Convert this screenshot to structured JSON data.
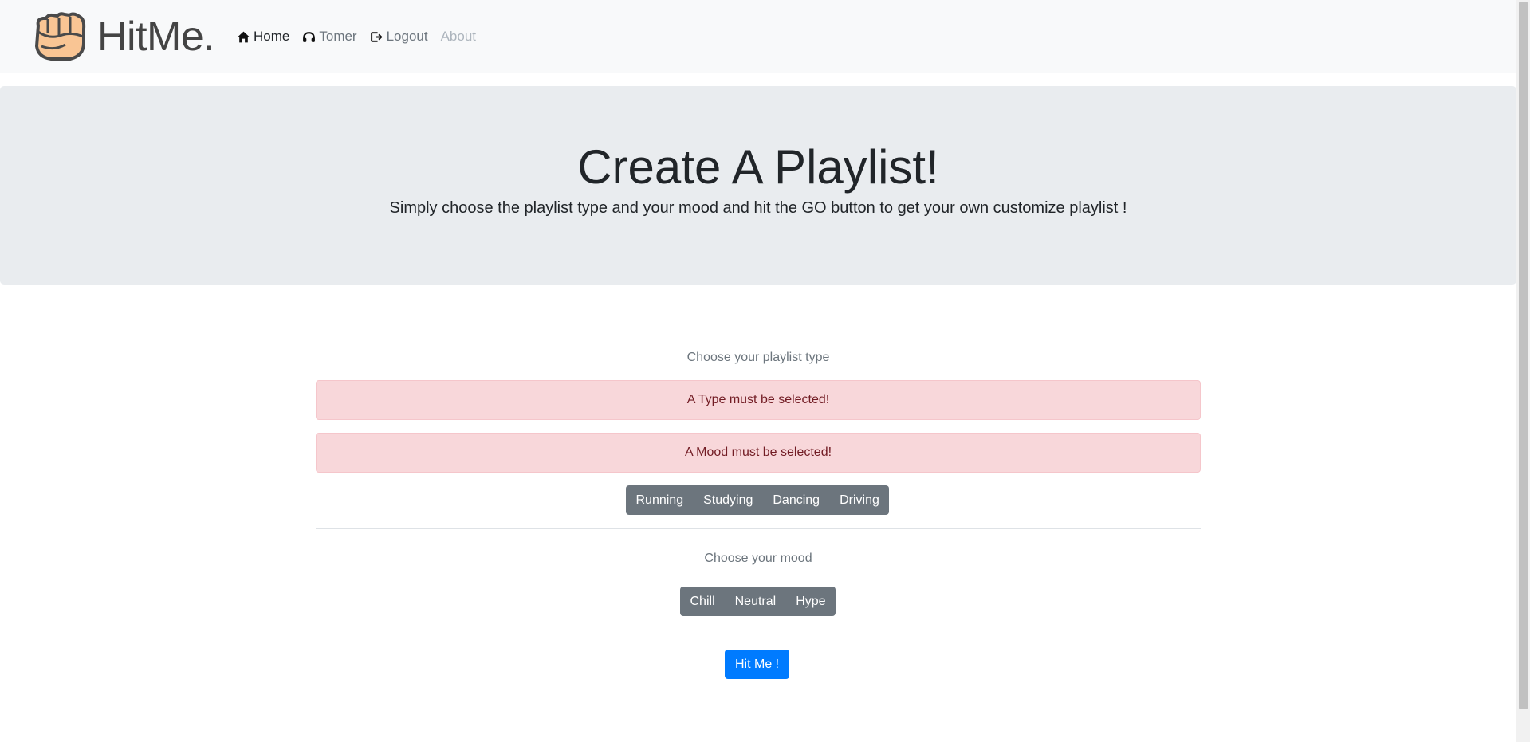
{
  "brand": {
    "name": "HitMe.",
    "logo_icon": "fist-icon"
  },
  "nav": {
    "home": "Home",
    "user": "Tomer",
    "logout": "Logout",
    "about": "About"
  },
  "hero": {
    "title": "Create A Playlist!",
    "lead": "Simply choose the playlist type and your mood and hit the GO button to get your own customize playlist !"
  },
  "type_section": {
    "label": "Choose your playlist type",
    "options": [
      "Running",
      "Studying",
      "Dancing",
      "Driving"
    ]
  },
  "alerts": {
    "type_error": "A Type must be selected!",
    "mood_error": "A Mood must be selected!"
  },
  "mood_section": {
    "label": "Choose your mood",
    "options": [
      "Chill",
      "Neutral",
      "Hype"
    ]
  },
  "submit": {
    "label": "Hit Me !"
  },
  "colors": {
    "primary": "#007bff",
    "secondary": "#6c757d",
    "danger_bg": "#f8d7da",
    "danger_text": "#721c24"
  }
}
